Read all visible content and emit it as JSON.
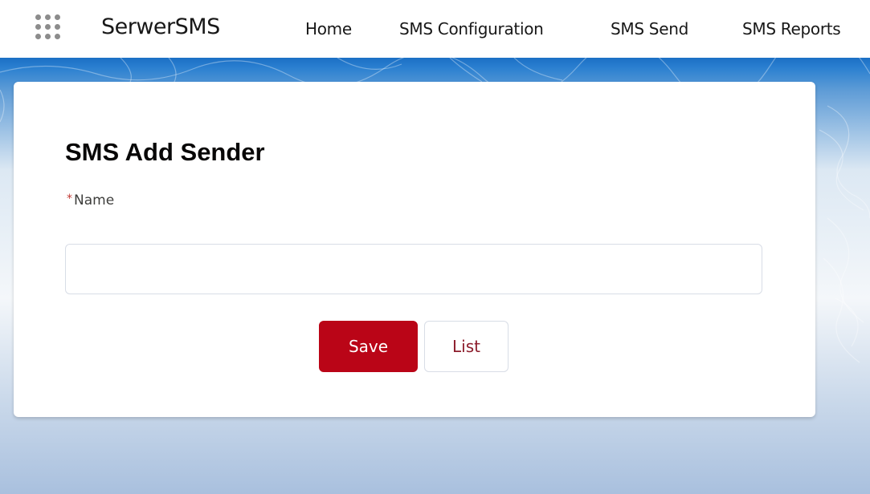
{
  "app": {
    "name": "SerwerSMS",
    "launcher_icon": "app-launcher-grid-icon"
  },
  "nav": {
    "items": [
      {
        "label": "Home"
      },
      {
        "label": "SMS Configuration"
      },
      {
        "label": "SMS Send"
      },
      {
        "label": "SMS Reports"
      }
    ]
  },
  "form": {
    "title": "SMS Add Sender",
    "name_label": "Name",
    "required_marker": "*",
    "name_value": "",
    "save_label": "Save",
    "list_label": "List"
  },
  "colors": {
    "brand_button": "#ba0517",
    "list_text": "#8c1c2b",
    "header_band": "#1b6fc4"
  }
}
